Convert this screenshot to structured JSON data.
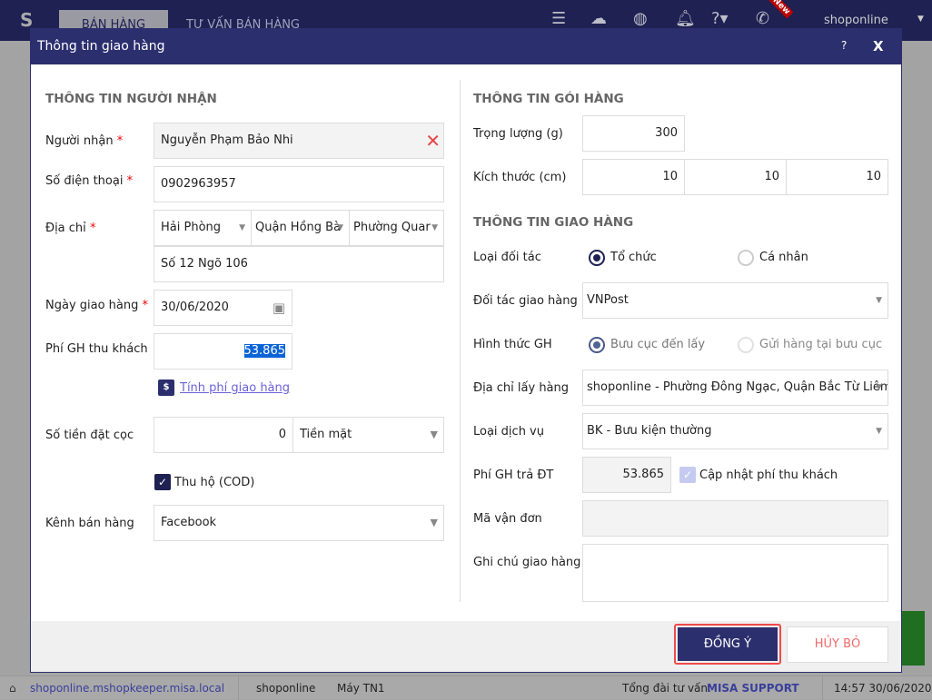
{
  "topbar": {
    "tab_sales": "BÁN HÀNG",
    "tab_consult": "TƯ VẤN BÁN HÀNG",
    "user": "shoponline",
    "new_badge": "New"
  },
  "dialog": {
    "title": "Thông tin giao hàng",
    "help": "?",
    "close": "X"
  },
  "recipient": {
    "heading": "THÔNG TIN NGƯỜI NHẬN",
    "name_label": "Người nhận",
    "name": "Nguyễn Phạm Bảo Nhi",
    "phone_label": "Số điện thoại",
    "phone": "0902963957",
    "address_label": "Địa chỉ",
    "city": "Hải Phòng",
    "district": "Quận Hồng Bà",
    "ward": "Phường Quar",
    "street": "Số 12 Ngõ 106",
    "date_label": "Ngày giao hàng",
    "date": "30/06/2020",
    "fee_label": "Phí GH thu khách",
    "fee": "53.865",
    "calc_link": "Tính phí giao hàng",
    "deposit_label": "Số tiền đặt cọc",
    "deposit": "0",
    "deposit_method": "Tiền mặt",
    "cod_label": "Thu hộ (COD)",
    "cod_checked": true,
    "channel_label": "Kênh bán hàng",
    "channel": "Facebook",
    "required": "*"
  },
  "package": {
    "heading": "THÔNG TIN GÓI HÀNG",
    "weight_label": "Trọng lượng (g)",
    "weight": "300",
    "size_label": "Kích thước (cm)",
    "length": "10",
    "width": "10",
    "height": "10"
  },
  "shipping": {
    "heading": "THÔNG TIN GIAO HÀNG",
    "partner_type_label": "Loại đối tác",
    "type_org": "Tổ chức",
    "type_person": "Cá nhân",
    "partner_label": "Đối tác giao hàng",
    "partner": "VNPost",
    "method_label": "Hình thức GH",
    "method_pickup": "Bưu cục đến lấy",
    "method_dropoff": "Gửi hàng tại bưu cục",
    "pickup_label": "Địa chỉ lấy hàng",
    "pickup": "shoponline - Phường Đông Ngạc, Quận Bắc Từ Liêm,",
    "service_label": "Loại dịch vụ",
    "service": "BK - Bưu kiện thường",
    "partner_fee_label": "Phí GH trả ĐT",
    "partner_fee": "53.865",
    "update_fee_label": "Cập nhật phí thu khách",
    "tracking_label": "Mã vận đơn",
    "tracking": "",
    "note_label": "Ghi chú giao hàng",
    "note": ""
  },
  "footer": {
    "ok": "ĐỒNG Ý",
    "cancel": "HỦY BỎ"
  },
  "status": {
    "url": "shoponline.mshopkeeper.misa.local",
    "shop": "shoponline",
    "machine": "Máy TN1",
    "hotline_label": "Tổng đài tư vấn:",
    "hotline": "MISA SUPPORT",
    "datetime": "14:57 30/06/2020"
  }
}
